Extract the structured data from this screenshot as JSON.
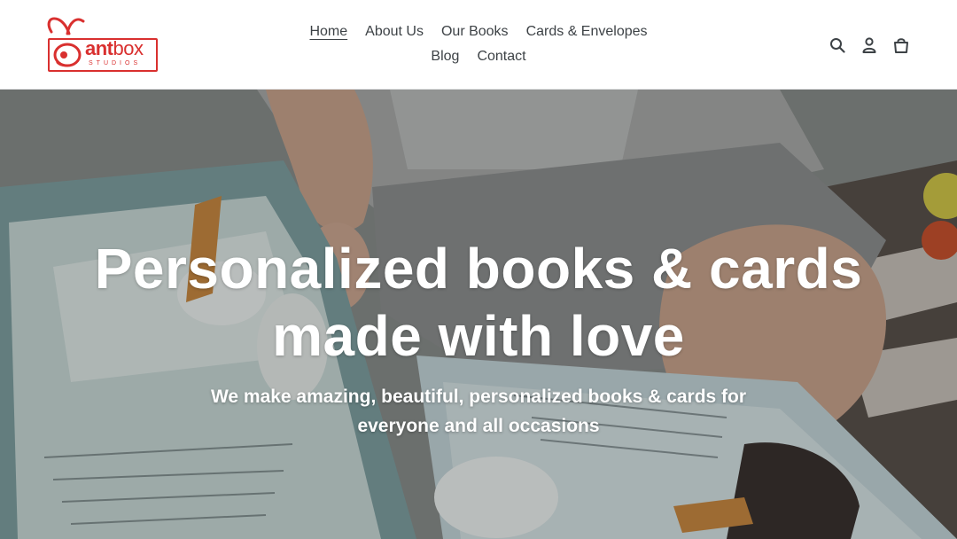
{
  "brand": {
    "name_part1": "ant",
    "name_part2": "box",
    "tagline": "STUDIOS",
    "accent_color": "#d9302f"
  },
  "nav": {
    "items": [
      {
        "label": "Home",
        "active": true
      },
      {
        "label": "About Us",
        "active": false
      },
      {
        "label": "Our Books",
        "active": false
      },
      {
        "label": "Cards & Envelopes",
        "active": false
      },
      {
        "label": "Blog",
        "active": false
      },
      {
        "label": "Contact",
        "active": false
      }
    ]
  },
  "header_icons": [
    "search-icon",
    "account-icon",
    "cart-icon"
  ],
  "hero": {
    "title_line1": "Personalized books & cards",
    "title_line2": "made with love",
    "subtitle": "We make amazing, beautiful, personalized books & cards for everyone and all occasions"
  }
}
